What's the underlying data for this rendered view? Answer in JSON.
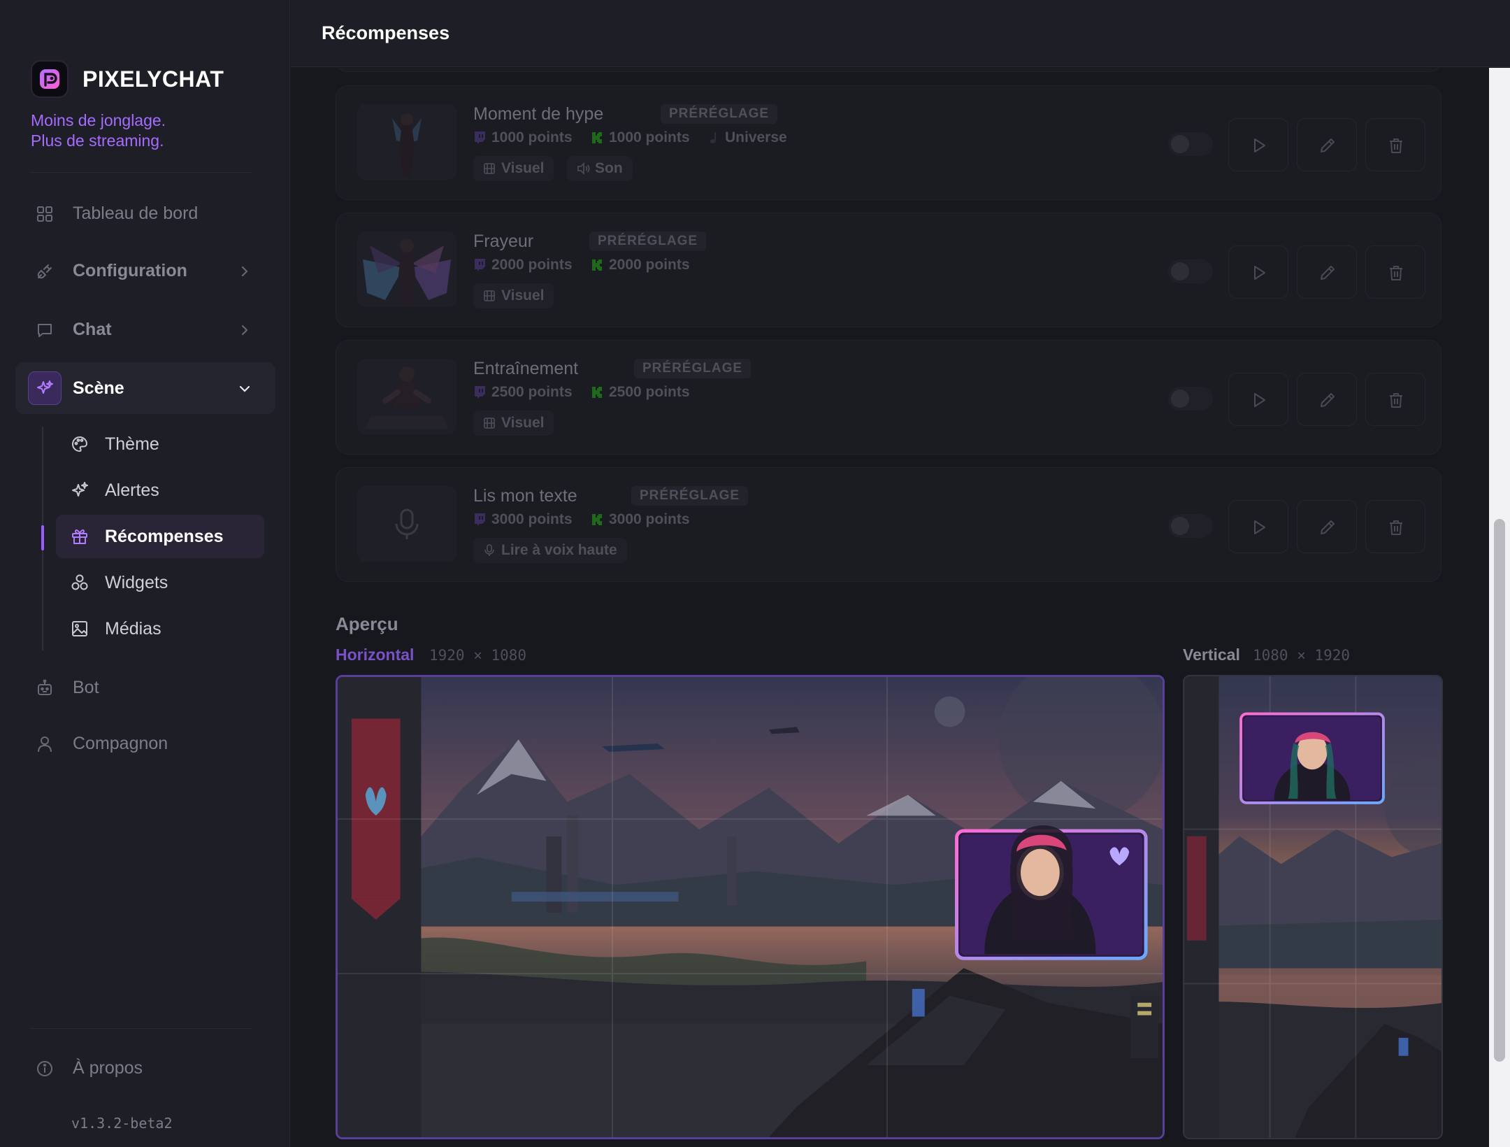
{
  "app": {
    "name": "PIXELYCHAT",
    "tagline_line1": "Moins de jonglage.",
    "tagline_line2": "Plus de streaming.",
    "version": "v1.3.2-beta2"
  },
  "header": {
    "title": "Récompenses"
  },
  "sidebar": {
    "items": [
      {
        "label": "Tableau de bord",
        "icon": "grid-icon"
      },
      {
        "label": "Configuration",
        "icon": "plug-icon"
      },
      {
        "label": "Chat",
        "icon": "chat-bubble-icon"
      },
      {
        "label": "Scène",
        "icon": "sparkles-icon"
      },
      {
        "label": "Bot",
        "icon": "robot-icon"
      },
      {
        "label": "Compagnon",
        "icon": "user-icon"
      }
    ],
    "scene_children": [
      {
        "label": "Thème",
        "icon": "palette-icon"
      },
      {
        "label": "Alertes",
        "icon": "sparkles-icon"
      },
      {
        "label": "Récompenses",
        "icon": "gift-icon"
      },
      {
        "label": "Widgets",
        "icon": "widgets-icon"
      },
      {
        "label": "Médias",
        "icon": "image-icon"
      }
    ],
    "about": "À propos"
  },
  "rewards": [
    {
      "name": "Moment de hype",
      "badge": "PRÉRÉGLAGE",
      "twitch_points": "1000 points",
      "kick_points": "1000 points",
      "sound_name": "Universe",
      "chips": [
        "Visuel",
        "Son"
      ],
      "enabled": false
    },
    {
      "name": "Frayeur",
      "badge": "PRÉRÉGLAGE",
      "twitch_points": "2000 points",
      "kick_points": "2000 points",
      "chips": [
        "Visuel"
      ],
      "enabled": false
    },
    {
      "name": "Entraînement",
      "badge": "PRÉRÉGLAGE",
      "twitch_points": "2500 points",
      "kick_points": "2500 points",
      "chips": [
        "Visuel"
      ],
      "enabled": false
    },
    {
      "name": "Lis mon texte",
      "badge": "PRÉRÉGLAGE",
      "twitch_points": "3000 points",
      "kick_points": "3000 points",
      "chips": [
        "Lire à voix haute"
      ],
      "enabled": false
    }
  ],
  "preview": {
    "title": "Aperçu",
    "horizontal_label": "Horizontal",
    "horizontal_dims": "1920 × 1080",
    "vertical_label": "Vertical",
    "vertical_dims": "1080 × 1920"
  },
  "colors": {
    "accent": "#9a5cff",
    "tagline": "#a66bff",
    "kick_green": "#53fc18",
    "twitch_purple": "#9146ff"
  }
}
